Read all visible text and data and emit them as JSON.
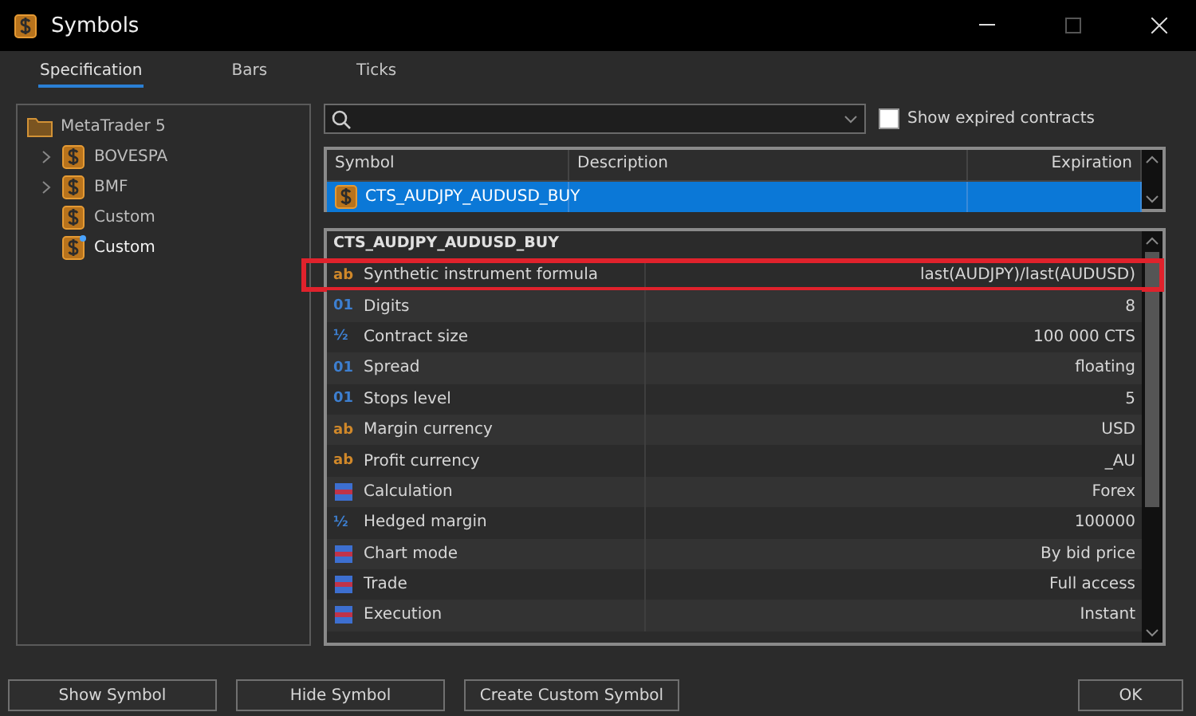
{
  "window": {
    "title": "Symbols"
  },
  "tabs": [
    {
      "label": "Specification",
      "selected": true
    },
    {
      "label": "Bars",
      "selected": false
    },
    {
      "label": "Ticks",
      "selected": false
    }
  ],
  "tree": {
    "label": "MetaTrader 5",
    "children": [
      {
        "label": "BOVESPA",
        "kind": "group",
        "expanded": false,
        "selected": false
      },
      {
        "label": "BMF",
        "kind": "group",
        "expanded": false,
        "selected": false
      },
      {
        "label": "Custom",
        "kind": "leaf",
        "selected": false
      },
      {
        "label": "Custom",
        "kind": "leaf-new",
        "selected": true
      }
    ]
  },
  "show_expired": {
    "label": "Show expired contracts",
    "checked": false
  },
  "symbols_table": {
    "columns": [
      "Symbol",
      "Description",
      "Expiration"
    ],
    "rows": [
      {
        "symbol": "CTS_AUDJPY_AUDUSD_BUY",
        "selected": true
      }
    ]
  },
  "properties": {
    "title": "CTS_AUDJPY_AUDUSD_BUY",
    "rows": [
      {
        "kind": "text",
        "icon": "ab",
        "name": "Synthetic instrument formula",
        "value": "last(AUDJPY)/last(AUDUSD)",
        "highlighted": true
      },
      {
        "kind": "integer",
        "icon": "01",
        "name": "Digits",
        "value": "8",
        "highlighted": false
      },
      {
        "kind": "fraction",
        "icon": "½",
        "name": "Contract size",
        "value": "100 000 CTS",
        "highlighted": false
      },
      {
        "kind": "integer",
        "icon": "01",
        "name": "Spread",
        "value": "floating",
        "highlighted": false
      },
      {
        "kind": "integer",
        "icon": "01",
        "name": "Stops level",
        "value": "5",
        "highlighted": false
      },
      {
        "kind": "text",
        "icon": "ab",
        "name": "Margin currency",
        "value": "USD",
        "highlighted": false
      },
      {
        "kind": "text",
        "icon": "ab",
        "name": "Profit currency",
        "value": "_AU",
        "highlighted": false
      },
      {
        "kind": "enum",
        "name": "Calculation",
        "value": "Forex",
        "highlighted": false
      },
      {
        "kind": "fraction",
        "icon": "½",
        "name": "Hedged margin",
        "value": "100000",
        "highlighted": false
      },
      {
        "kind": "enum",
        "name": "Chart mode",
        "value": "By bid price",
        "highlighted": false
      },
      {
        "kind": "enum",
        "name": "Trade",
        "value": "Full access",
        "highlighted": false
      },
      {
        "kind": "enum",
        "name": "Execution",
        "value": "Instant",
        "highlighted": false
      }
    ]
  },
  "buttons": [
    {
      "label": "Show Symbol"
    },
    {
      "label": "Hide Symbol"
    },
    {
      "label": "Create Custom Symbol"
    }
  ],
  "ok_button": {
    "label": "OK"
  }
}
